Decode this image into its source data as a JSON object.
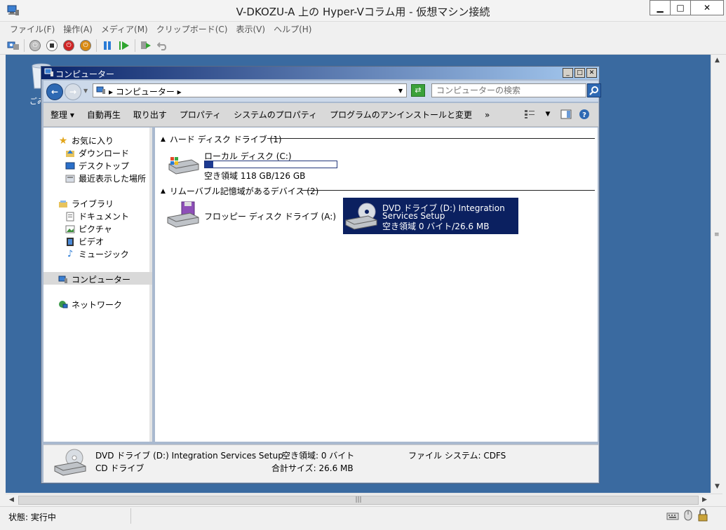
{
  "window": {
    "title": "V-DKOZU-A 上の Hyper-Vコラム用  - 仮想マシン接続",
    "minimize": "▁",
    "maximize": "□",
    "close": "✕"
  },
  "menu": [
    "ファイル(F)",
    "操作(A)",
    "メディア(M)",
    "クリップボード(C)",
    "表示(V)",
    "ヘルプ(H)"
  ],
  "desktop": {
    "recycle_label": "ごみ"
  },
  "explorer": {
    "title": "コンピューター",
    "address_crumb": "▸ コンピューター ▸",
    "search_placeholder": "コンピューターの検索",
    "commands": [
      "整理 ▾",
      "自動再生",
      "取り出す",
      "プロパティ",
      "システムのプロパティ",
      "プログラムのアンインストールと変更",
      "»"
    ],
    "nav": {
      "favorites": "お気に入り",
      "downloads": "ダウンロード",
      "desktop": "デスクトップ",
      "recent": "最近表示した場所",
      "libraries": "ライブラリ",
      "documents": "ドキュメント",
      "pictures": "ピクチャ",
      "videos": "ビデオ",
      "music": "ミュージック",
      "computer": "コンピューター",
      "network": "ネットワーク"
    },
    "groups": {
      "hdd": "ハード ディスク ドライブ (1)",
      "removable": "リムーバブル記憶域があるデバイス (2)"
    },
    "local_disk": {
      "name": "ローカル ディスク (C:)",
      "free": "空き領域 118 GB/126 GB",
      "used_fraction": 0.063
    },
    "floppy": {
      "name": "フロッピー ディスク ドライブ (A:)"
    },
    "dvd": {
      "line1": "DVD ドライブ (D:) Integration",
      "line2": "Services Setup",
      "line3": "空き領域 0 バイト/26.6 MB"
    },
    "details": {
      "name": "DVD ドライブ (D:) Integration Services Setup",
      "type": "CD ドライブ",
      "free": "空き領域: 0 バイト",
      "total": "合計サイズ: 26.6 MB",
      "fs": "ファイル システム: CDFS"
    }
  },
  "status": {
    "text": "状態: 実行中"
  },
  "colors": {
    "desktop": "#3a6aa0",
    "selection": "#0b2060",
    "titlebar_gradient_start": "#0a246a"
  }
}
